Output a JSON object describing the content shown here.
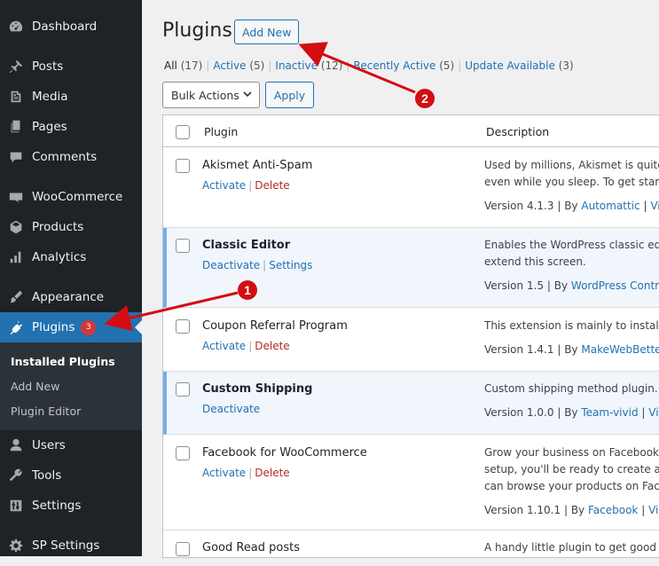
{
  "sidebar": {
    "items": [
      {
        "label": "Dashboard",
        "icon": "dashboard-icon"
      },
      {
        "label": "Posts",
        "icon": "pin-icon"
      },
      {
        "label": "Media",
        "icon": "media-icon"
      },
      {
        "label": "Pages",
        "icon": "pages-icon"
      },
      {
        "label": "Comments",
        "icon": "comment-icon"
      },
      {
        "label": "WooCommerce",
        "icon": "woo-icon"
      },
      {
        "label": "Products",
        "icon": "box-icon"
      },
      {
        "label": "Analytics",
        "icon": "bar-chart-icon"
      },
      {
        "label": "Appearance",
        "icon": "brush-icon"
      },
      {
        "label": "Plugins",
        "icon": "plugin-icon",
        "badge": "3"
      },
      {
        "label": "Users",
        "icon": "user-icon"
      },
      {
        "label": "Tools",
        "icon": "wrench-icon"
      },
      {
        "label": "Settings",
        "icon": "sliders-icon"
      },
      {
        "label": "SP Settings",
        "icon": "gear-icon"
      }
    ],
    "submenu": [
      "Installed Plugins",
      "Add New",
      "Plugin Editor"
    ]
  },
  "header": {
    "title": "Plugins",
    "add_new": "Add New"
  },
  "filters": [
    {
      "label": "All",
      "count": "(17)"
    },
    {
      "label": "Active",
      "count": "(5)"
    },
    {
      "label": "Inactive",
      "count": "(12)"
    },
    {
      "label": "Recently Active",
      "count": "(5)"
    },
    {
      "label": "Update Available",
      "count": "(3)"
    }
  ],
  "bulk": {
    "label": "Bulk Actions",
    "apply": "Apply"
  },
  "table": {
    "col_plugin": "Plugin",
    "col_description": "Description",
    "rows": [
      {
        "name": "Akismet Anti-Spam",
        "action1": "Activate",
        "action2": "Delete",
        "desc1": "Used by millions, Akismet is quite p",
        "desc2": "even while you sleep. To get starte",
        "version": "Version 4.1.3",
        "by": "By",
        "author": "Automattic",
        "view": "View",
        "active": false
      },
      {
        "name": "Classic Editor",
        "action1": "Deactivate",
        "action2": "Settings",
        "desc1": "Enables the WordPress classic edito",
        "desc2": "extend this screen.",
        "version": "Version 1.5",
        "by": "By",
        "author": "WordPress Contrib",
        "view": "",
        "active": true
      },
      {
        "name": "Coupon Referral Program",
        "action1": "Activate",
        "action2": "Delete",
        "desc1": "This extension is mainly to install a",
        "desc2": "",
        "version": "Version 1.4.1",
        "by": "By",
        "author": "MakeWebBetter",
        "view": "",
        "active": false
      },
      {
        "name": "Custom Shipping",
        "action1": "Deactivate",
        "action2": "",
        "desc1": "Custom shipping method plugin.",
        "desc2": "",
        "version": "Version 1.0.0",
        "by": "By",
        "author": "Team-vivid",
        "view": "Visit",
        "active": true
      },
      {
        "name": "Facebook for WooCommerce",
        "action1": "Activate",
        "action2": "Delete",
        "desc1": "Grow your business on Facebook!",
        "desc2": "setup, you'll be ready to create ads",
        "desc3": "can browse your products on Face",
        "version": "Version 1.10.1",
        "by": "By",
        "author": "Facebook",
        "view": "View",
        "active": false
      },
      {
        "name": "Good Read posts",
        "desc1": "A handy little plugin to get good r",
        "active": false
      }
    ]
  },
  "annotations": [
    {
      "label": "1",
      "color": "#d40d12"
    },
    {
      "label": "2",
      "color": "#d40d12"
    }
  ]
}
